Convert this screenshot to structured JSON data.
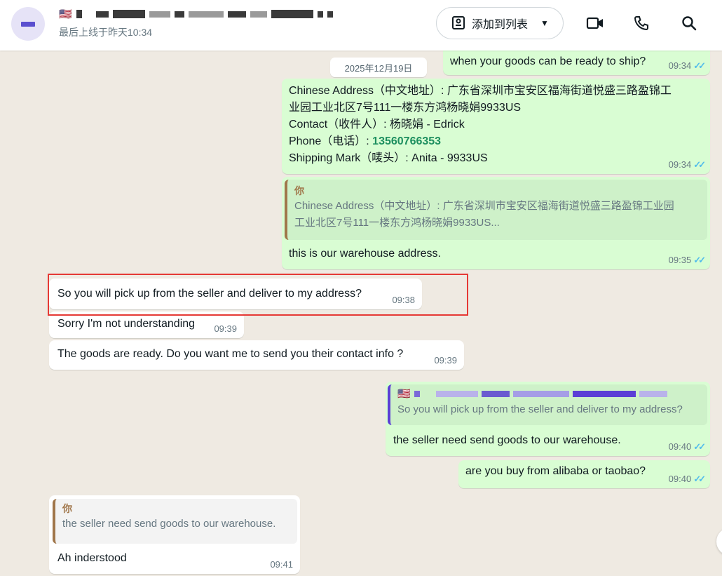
{
  "header": {
    "contact_flag": "🇺🇸",
    "last_seen": "最后上线于昨天10:34",
    "add_to_list_label": "添加到列表"
  },
  "chat": {
    "date_label": "2025年12月19日",
    "messages": [
      {
        "text": "when your goods can be ready to ship?",
        "time": "09:34"
      },
      {
        "lines": [
          "Chinese Address（中文地址）: 广东省深圳市宝安区福海街道悦盛三路盈锦工",
          "业园工业北区7号111一楼东方鸿杨晓娟9933US",
          "Contact（收件人）: 杨晓娟 - Edrick",
          "Shipping Mark（唛头）: Anita - 9933US"
        ],
        "phone_label": "Phone（电话）: ",
        "phone_number": "13560766353",
        "time": "09:34"
      },
      {
        "quote_author": "你",
        "quote_text_1": "Chinese Address（中文地址）: 广东省深圳市宝安区福海街道悦盛三路盈锦工业园",
        "quote_text_2": "工业北区7号111一楼东方鸿杨晓娟9933US...",
        "text": "this is our warehouse address.",
        "time": "09:35"
      },
      {
        "text": "So you will pick up from the seller and deliver to my address?",
        "time": "09:38"
      },
      {
        "text": "Sorry I'm not understanding",
        "time": "09:39"
      },
      {
        "text": "The goods are ready. Do you want me to send you their contact info ?",
        "time": "09:39"
      },
      {
        "quote_flag": "🇺🇸",
        "quote_text": "So you will pick up from the seller and deliver to my address?",
        "text": "the seller need send goods to our warehouse.",
        "time": "09:40"
      },
      {
        "text": "are you buy from alibaba or taobao?",
        "time": "09:40"
      },
      {
        "quote_author": "你",
        "quote_text": "the seller need send goods to our warehouse.",
        "text": "Ah inderstood",
        "time": "09:41"
      }
    ]
  },
  "colors": {
    "outgoing_bubble": "#d9fdd3",
    "incoming_bubble": "#ffffff",
    "read_ticks": "#53bdeb",
    "quote_self_bar": "#a0764a",
    "quote_contact_bar": "#5b3fd6",
    "highlight": "#e53935"
  }
}
